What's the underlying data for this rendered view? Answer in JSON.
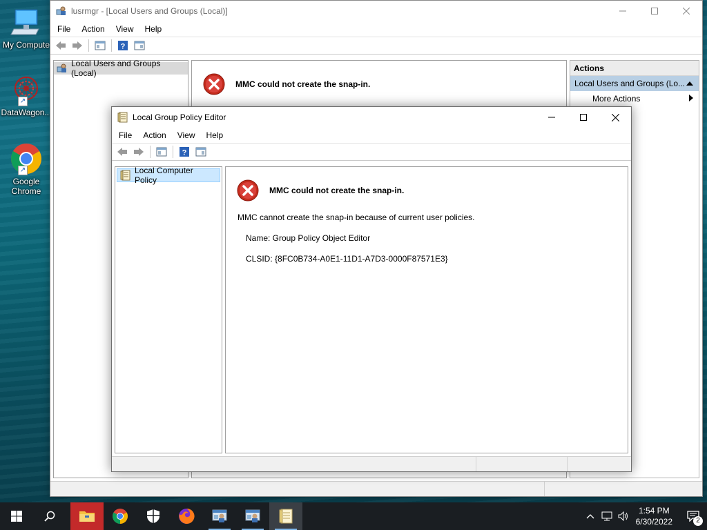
{
  "desktop": {
    "icons": [
      {
        "label": "My Compute"
      },
      {
        "label": "DataWagon..."
      },
      {
        "label": "Google Chrome"
      }
    ]
  },
  "lusrmgr": {
    "title": "lusrmgr - [Local Users and Groups (Local)]",
    "menu": [
      "File",
      "Action",
      "View",
      "Help"
    ],
    "tree_item": "Local Users and Groups (Local)",
    "error_title": "MMC could not create the snap-in.",
    "actions": {
      "header": "Actions",
      "section": "Local Users and Groups (Lo...",
      "more": "More Actions"
    }
  },
  "gpedit": {
    "title": "Local Group Policy Editor",
    "menu": [
      "File",
      "Action",
      "View",
      "Help"
    ],
    "tree_item": "Local Computer Policy",
    "error_title": "MMC could not create the snap-in.",
    "error_message": "MMC cannot create the snap-in because of current user policies.",
    "name_line": "Name: Group Policy Object Editor",
    "clsid_line": "CLSID: {8FC0B734-A0E1-11D1-A7D3-0000F87571E3}"
  },
  "taskbar": {
    "apps": [
      "start-icon",
      "search-icon",
      "file-explorer-icon",
      "chrome-icon",
      "security-shield-icon",
      "firefox-icon",
      "mmc-icon",
      "mmc-icon",
      "gpedit-icon"
    ],
    "time": "1:54 PM",
    "date": "6/30/2022",
    "notification_count": "2"
  },
  "colors": {
    "selection_blue": "#cce8ff",
    "actions_sub": "#b8cfe4",
    "error_red": "#c42b1c"
  }
}
